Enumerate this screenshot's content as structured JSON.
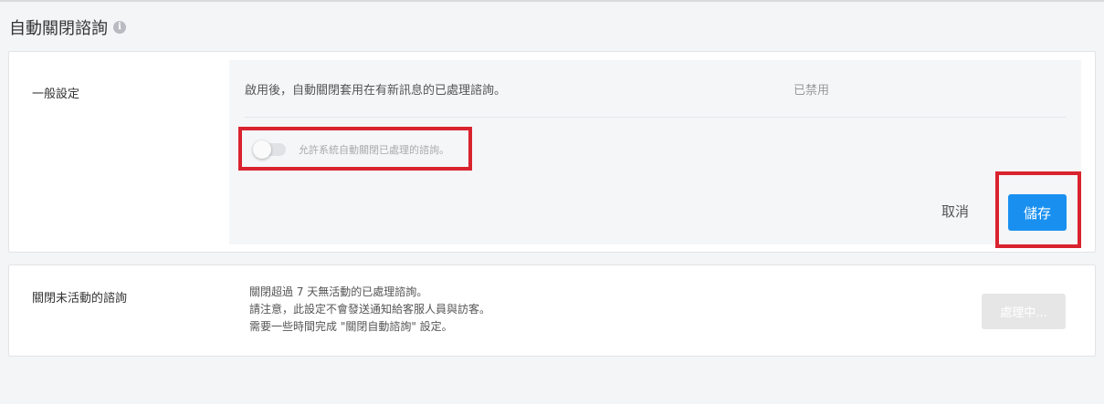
{
  "page": {
    "title": "自動關閉諮詢",
    "info_icon": "i"
  },
  "general": {
    "label": "一般設定",
    "description": "啟用後，自動關閉套用在有新訊息的已處理諮詢。",
    "status": "已禁用",
    "toggle_label": "允許系統自動關閉已處理的諮詢。",
    "toggle_on": false,
    "cancel_label": "取消",
    "save_label": "儲存"
  },
  "inactive": {
    "label": "關閉未活動的諮詢",
    "lines": [
      "關閉超過 7 天無活動的已處理諮詢。",
      "請注意，此設定不會發送通知給客服人員與訪客。",
      "需要一些時間完成 \"關閉自動諮詢\" 設定。"
    ],
    "processing_label": "處理中..."
  },
  "colors": {
    "primary": "#1990f0",
    "highlight": "#d9232e",
    "disabled": "#e6e6e6"
  }
}
